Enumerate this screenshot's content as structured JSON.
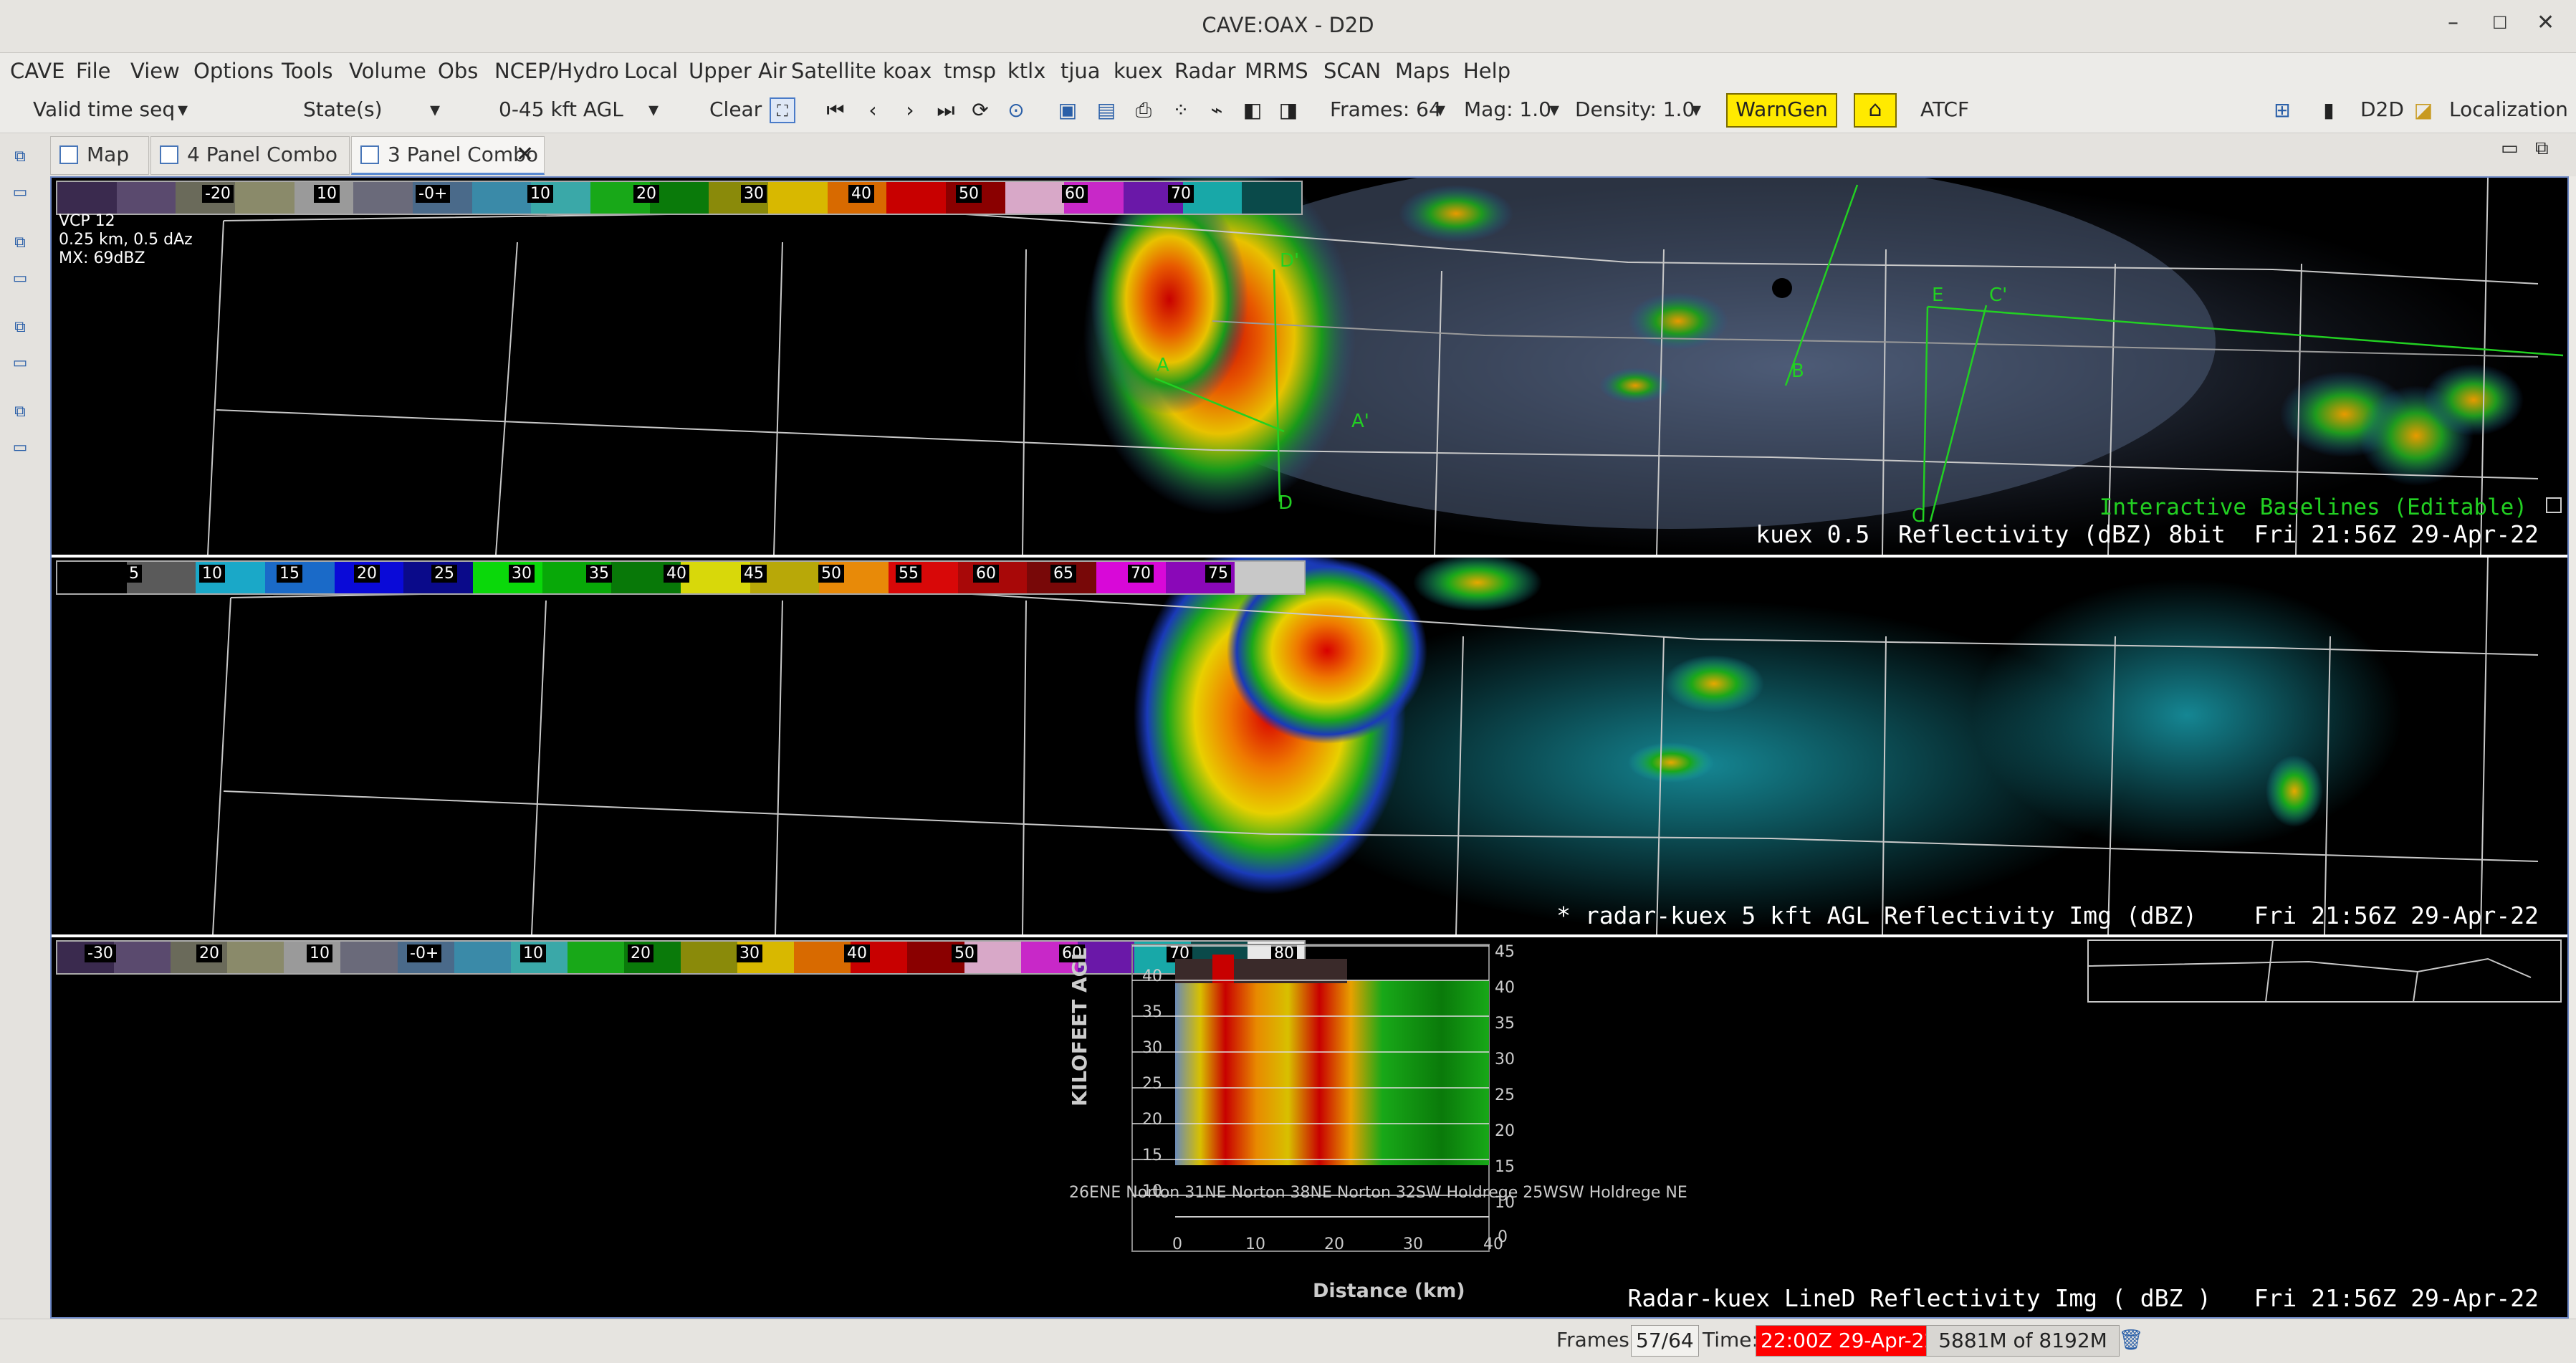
{
  "window": {
    "title": "CAVE:OAX - D2D",
    "minimize": "–",
    "maximize": "☐",
    "close": "✕"
  },
  "menu": [
    "CAVE",
    "File",
    "View",
    "Options",
    "Tools",
    "Volume",
    "Obs",
    "NCEP/Hydro",
    "Local",
    "Upper Air",
    "Satellite",
    "koax",
    "tmsp",
    "ktlx",
    "tjua",
    "kuex",
    "Radar",
    "MRMS",
    "SCAN",
    "Maps",
    "Help"
  ],
  "toolbar": {
    "time_seq": "Valid time seq",
    "states": "State(s)",
    "height": "0-45 kft AGL",
    "clear": "Clear",
    "frames": "Frames: 64",
    "mag": "Mag: 1.0",
    "density": "Density: 1.0",
    "warngen": "WarnGen",
    "atcf": "ATCF",
    "d2d": "D2D",
    "localization": "Localization"
  },
  "tabs": [
    {
      "label": "Map"
    },
    {
      "label": "4 Panel Combo"
    },
    {
      "label": "3 Panel Combo",
      "close": "✕"
    }
  ],
  "panel1": {
    "colorbar_labels": [
      "-20",
      "10",
      "-0+",
      "10",
      "20",
      "30",
      "40",
      "50",
      "60",
      "70"
    ],
    "info": [
      "VCP 12",
      "0.25 km, 0.5 dAz",
      "MX: 69dBZ"
    ],
    "baselines": "Interactive Baselines (Editable)",
    "title": "kuex 0.5  Reflectivity (dBZ) 8bit  Fri 21:56Z 29-Apr-22",
    "baseline_letters": [
      "A",
      "A'",
      "B",
      "B'",
      "C",
      "C'",
      "D",
      "D'",
      "E"
    ]
  },
  "panel2": {
    "colorbar_labels": [
      "5",
      "10",
      "15",
      "20",
      "25",
      "30",
      "35",
      "40",
      "45",
      "50",
      "55",
      "60",
      "65",
      "70",
      "75"
    ],
    "title": "* radar-kuex 5 kft AGL Reflectivity Img (dBZ)    Fri 21:56Z 29-Apr-22"
  },
  "panel3": {
    "colorbar_labels": [
      "-30",
      "20",
      "10",
      "-0+",
      "10",
      "20",
      "30",
      "40",
      "50",
      "60",
      "70",
      "80"
    ],
    "title": "Radar-kuex LineD Reflectivity Img ( dBZ )   Fri 21:56Z 29-Apr-22",
    "ylabel": "KILOFEET AGL",
    "xlabel": "Distance (km)",
    "yticks_left": [
      "40",
      "35",
      "30",
      "25",
      "20",
      "15",
      "10"
    ],
    "yticks_right": [
      "45",
      "40",
      "35",
      "30",
      "25",
      "20",
      "15",
      "10"
    ],
    "xticks": [
      "0",
      "10",
      "20",
      "30",
      "40"
    ],
    "xzero_right": "0",
    "places": "26ENE Norton 31NE Norton 38NE Norton 32SW Holdrege 25WSW Holdrege NE"
  },
  "status": {
    "frames_label": "Frames:",
    "frames_value": "57/64",
    "time_label": "Time:",
    "time_value": "22:00Z 29-Apr-22",
    "memory": "5881M of 8192M"
  },
  "colors": {
    "accent": "#ffea00",
    "time_bg": "#ff0000",
    "baseline": "#22d022"
  }
}
